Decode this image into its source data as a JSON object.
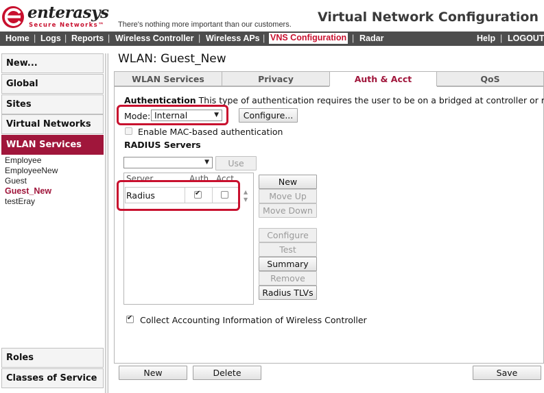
{
  "header": {
    "brand": "enterasys",
    "brand_sub": "Secure Networks™",
    "tagline": "There's nothing more important than our customers.",
    "page_heading": "Virtual Network Configuration"
  },
  "nav": {
    "items": [
      "Home",
      "Logs",
      "Reports",
      "Wireless Controller",
      "Wireless APs",
      "VNS Configuration",
      "Radar"
    ],
    "active": "VNS Configuration",
    "right_items": [
      "Help",
      "LOGOUT"
    ],
    "separator": "|"
  },
  "sidebar": {
    "boxes": [
      "New...",
      "Global",
      "Sites",
      "Virtual Networks",
      "WLAN Services"
    ],
    "active_box": "WLAN Services",
    "links": [
      "Employee",
      "EmployeeNew",
      "Guest",
      "Guest_New",
      "testEray"
    ],
    "current_link": "Guest_New",
    "bottom_boxes": [
      "Roles",
      "Classes of Service"
    ]
  },
  "main": {
    "title": "WLAN: Guest_New",
    "tabs": [
      "WLAN Services",
      "Privacy",
      "Auth & Acct",
      "QoS"
    ],
    "active_tab": "Auth & Acct"
  },
  "auth": {
    "heading": "Authentication",
    "description": "This type of authentication requires the user to be on a bridged at controller or routed",
    "mode_label": "Mode:",
    "mode_value": "Internal",
    "configure_button": "Configure...",
    "mac_auth_label": "Enable MAC-based authentication",
    "mac_auth_checked": false
  },
  "radius": {
    "heading": "RADIUS Servers",
    "server_select_value": "",
    "use_button": "Use",
    "columns": [
      "Server",
      "Auth",
      "Acct"
    ],
    "rows": [
      {
        "server": "Radius",
        "auth": true,
        "acct": false
      }
    ],
    "side_buttons": [
      "New",
      "Move Up",
      "Move Down"
    ],
    "action_buttons": [
      "Configure",
      "Test",
      "Summary",
      "Remove",
      "Radius TLVs"
    ],
    "collect_label": "Collect Accounting Information of Wireless Controller",
    "collect_checked": true
  },
  "footer": {
    "new_button": "New",
    "delete_button": "Delete",
    "save_button": "Save"
  },
  "colors": {
    "accent": "#a0163b",
    "brand_red": "#c8102e",
    "nav_bg": "#4d4d4d",
    "highlight": "#c8102e"
  }
}
